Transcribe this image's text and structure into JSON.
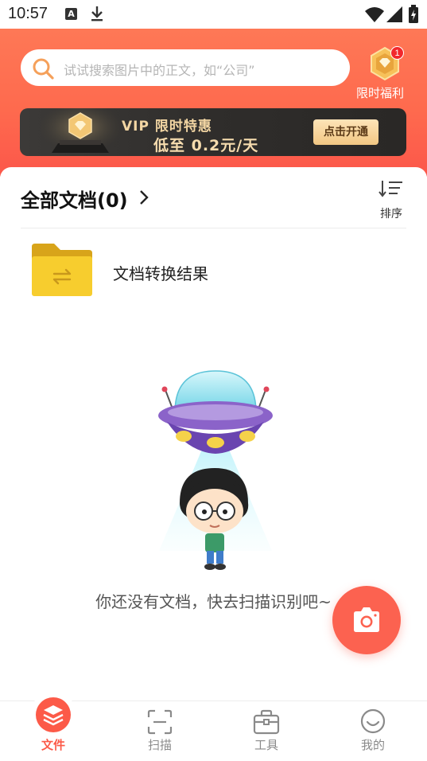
{
  "status_bar": {
    "time": "10:57",
    "a_badge": "A"
  },
  "search": {
    "placeholder": "试试搜索图片中的正文，如“公司”"
  },
  "gift": {
    "badge_count": "1",
    "label": "限时福利"
  },
  "vip_banner": {
    "title": "VIP 限时特惠",
    "subtitle": "低至 0.2元/天",
    "button": "点击开通"
  },
  "documents": {
    "title": "全部文档(0)",
    "sort_label": "排序",
    "folder_label": "文档转换结果",
    "empty_message": "你还没有文档，快去扫描识别吧~"
  },
  "nav": {
    "items": [
      {
        "label": "文件",
        "icon": "layers-icon",
        "active": true
      },
      {
        "label": "扫描",
        "icon": "scan-icon",
        "active": false
      },
      {
        "label": "工具",
        "icon": "toolbox-icon",
        "active": false
      },
      {
        "label": "我的",
        "icon": "smile-icon",
        "active": false
      }
    ]
  },
  "colors": {
    "header_start": "#fe7856",
    "header_end": "#fc574a",
    "accent": "#fc5a48",
    "vip_gold": "#f3d6a3",
    "folder_yellow": "#f7cd2e"
  }
}
